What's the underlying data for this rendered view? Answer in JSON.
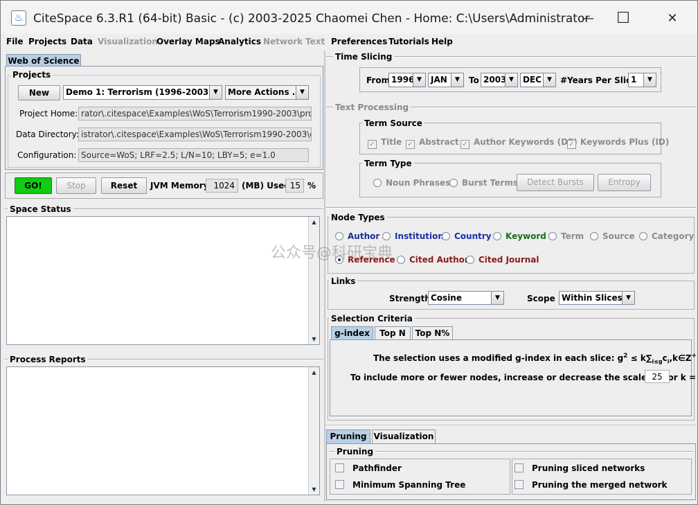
{
  "window": {
    "title": "CiteSpace 6.3.R1 (64-bit) Basic - (c) 2003-2025 Chaomei Chen - Home: C:\\Users\\Administrator",
    "minimize_glyph": "—",
    "maximize_glyph": "☐",
    "close_glyph": "✕"
  },
  "menubar": {
    "items": [
      "File",
      "Projects",
      "Data",
      "Visualization",
      "Overlay Maps",
      "Analytics",
      "Network",
      "Text",
      "Preferences",
      "Tutorials",
      "Help"
    ]
  },
  "left": {
    "tab": "Web of Science",
    "projects": {
      "legend": "Projects",
      "new_label": "New",
      "project_selected": "Demo 1: Terrorism (1996-2003)",
      "more_actions": "More Actions ...",
      "project_home_label": "Project Home:",
      "project_home_value": "rator\\.citespace\\Examples\\WoS\\Terrorism1990-2003\\project",
      "data_dir_label": "Data Directory:",
      "data_dir_value": "istrator\\.citespace\\Examples\\WoS\\Terrorism1990-2003\\data",
      "config_label": "Configuration:",
      "config_value": "Source=WoS; LRF=2.5; L/N=10; LBY=5; e=1.0"
    },
    "controls": {
      "go": "GO!",
      "stop": "Stop",
      "reset": "Reset",
      "jvm_label": "JVM Memory",
      "jvm_value": "1024",
      "mb_used_label": "(MB) Used",
      "used_value": "15",
      "percent": "%"
    },
    "space_status": "Space Status",
    "process_reports": "Process Reports"
  },
  "right": {
    "time_slicing": {
      "legend": "Time Slicing",
      "from_label": "From",
      "from_year": "1996",
      "from_month": "JAN",
      "to_label": "To",
      "to_year": "2003",
      "to_month": "DEC",
      "years_per_slice_label": "#Years Per Slice",
      "years_per_slice": "1"
    },
    "text_processing": {
      "legend": "Text Processing",
      "term_source": "Term Source",
      "sources": [
        "Title",
        "Abstract",
        "Author Keywords (DE)",
        "Keywords Plus (ID)"
      ],
      "term_type": "Term Type",
      "noun_phrases": "Noun Phrases",
      "burst_terms": "Burst Terms",
      "detect_bursts": "Detect Bursts",
      "entropy": "Entropy"
    },
    "node_types": {
      "legend": "Node Types",
      "row1": [
        {
          "label": "Author",
          "color": "#1a2f8c"
        },
        {
          "label": "Institution",
          "color": "#1a2fa8"
        },
        {
          "label": "Country",
          "color": "#1a2fa8"
        },
        {
          "label": "Keyword",
          "color": "#1a6e1a"
        },
        {
          "label": "Term",
          "color": "#8c8c8c"
        },
        {
          "label": "Source",
          "color": "#8c8c8c"
        },
        {
          "label": "Category",
          "color": "#8c8c8c"
        }
      ],
      "row2": [
        {
          "label": "Reference",
          "color": "#8c1a1a"
        },
        {
          "label": "Cited Author",
          "color": "#8c1a1a"
        },
        {
          "label": "Cited Journal",
          "color": "#8c1a1a"
        }
      ]
    },
    "links": {
      "legend": "Links",
      "strength_label": "Strength",
      "strength_value": "Cosine",
      "scope_label": "Scope",
      "scope_value": "Within Slices"
    },
    "selection": {
      "legend": "Selection Criteria",
      "tabs": [
        "g-index",
        "Top N",
        "Top N%"
      ],
      "line1": "The selection uses a modified g-index in each slice: ",
      "formula_g": "g",
      "formula_2": "2",
      "formula_mid": " ≤ k∑",
      "formula_sub": "i≤g",
      "formula_c": "c",
      "formula_i": "i",
      "formula_end": ",k∈Z",
      "formula_plus": "+",
      "line2": "To include more or fewer nodes, increase or decrease the scale factor k =",
      "k_value": "25"
    },
    "bottom_tabs": [
      "Pruning",
      "Visualization"
    ],
    "pruning": {
      "legend": "Pruning",
      "pathfinder": "Pathfinder",
      "mst": "Minimum Spanning Tree",
      "pruning_sliced": "Pruning sliced networks",
      "pruning_merged": "Pruning the merged network"
    }
  },
  "watermark": "公众号@科研宝典"
}
